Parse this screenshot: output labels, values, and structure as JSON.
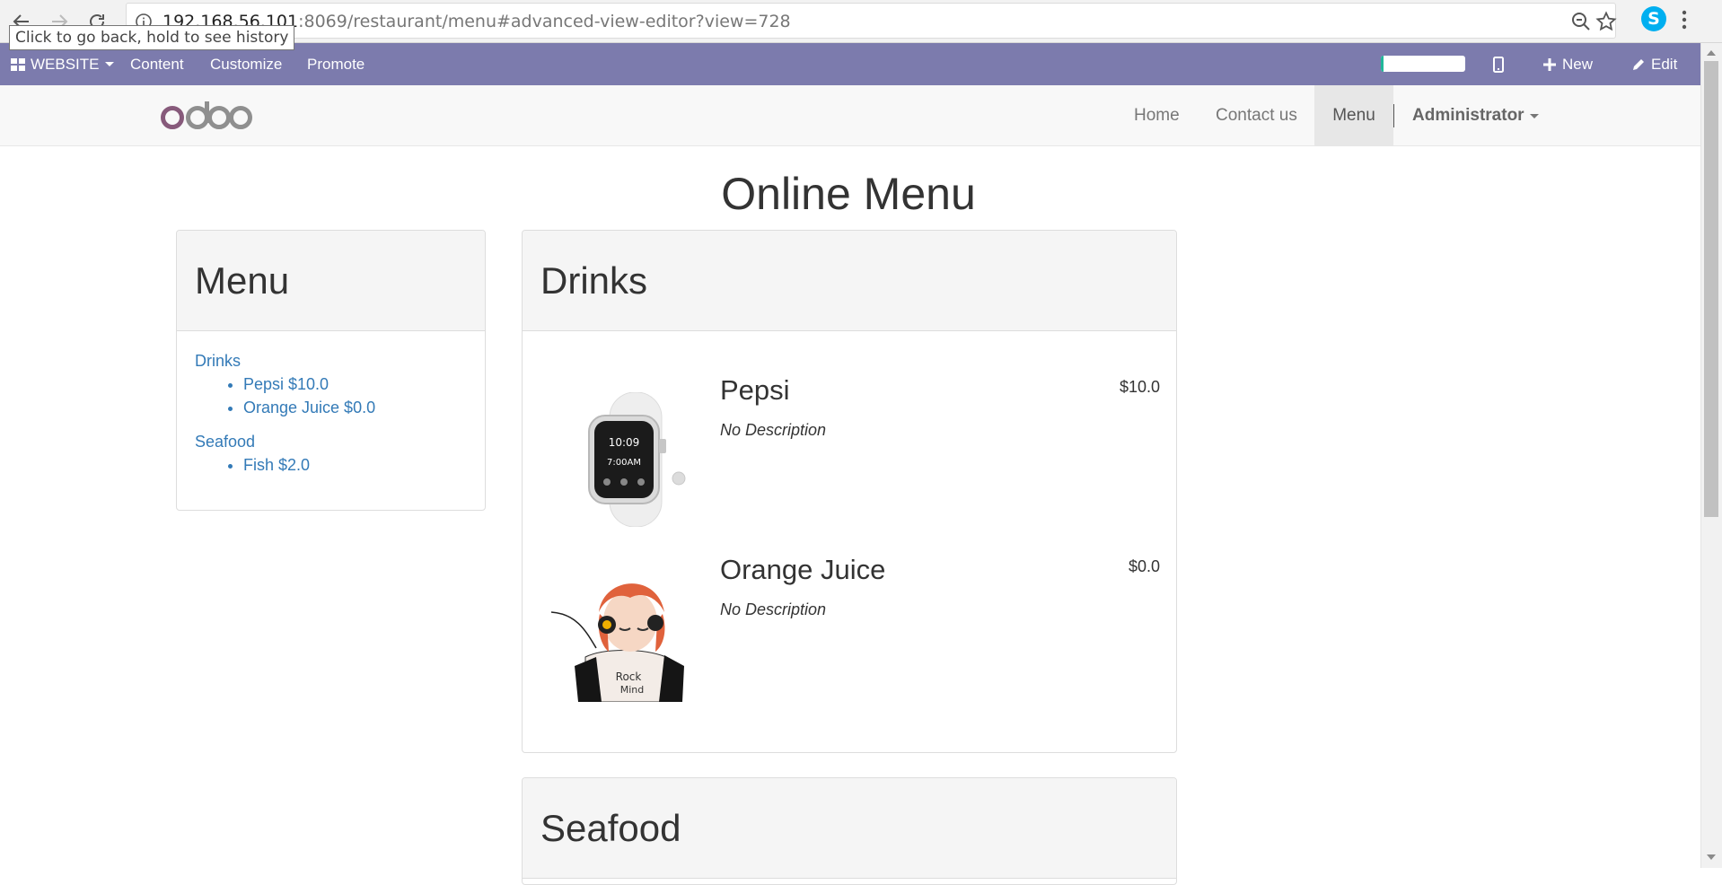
{
  "browser": {
    "url_host": "192.168.56.101",
    "url_path": ":8069/restaurant/menu#advanced-view-editor?view=728",
    "tooltip": "Click to go back, hold to see history"
  },
  "admin_bar": {
    "website_label": "WEBSITE",
    "content_label": "Content",
    "customize_label": "Customize",
    "promote_label": "Promote",
    "new_label": "New",
    "edit_label": "Edit",
    "progress_percent": 3
  },
  "navbar": {
    "logo_text": "odoo",
    "links": [
      "Home",
      "Contact us",
      "Menu"
    ],
    "user_label": "Administrator"
  },
  "page": {
    "title": "Online Menu"
  },
  "sidebar": {
    "heading": "Menu",
    "categories": [
      {
        "name": "Drinks",
        "items": [
          "Pepsi $10.0",
          "Orange Juice $0.0"
        ]
      },
      {
        "name": "Seafood",
        "items": [
          "Fish $2.0"
        ]
      }
    ]
  },
  "sections": [
    {
      "heading": "Drinks",
      "items": [
        {
          "name": "Pepsi",
          "description": "No Description",
          "price": "$10.0",
          "image": "smartwatch-image"
        },
        {
          "name": "Orange Juice",
          "description": "No Description",
          "price": "$0.0",
          "image": "anime-girl-image"
        }
      ]
    },
    {
      "heading": "Seafood"
    }
  ],
  "colors": {
    "admin_bar": "#7c7bad",
    "logo_o": "#875a7b",
    "logo_doo": "#8f8f8f",
    "link": "#337ab7",
    "progress": "#21b799"
  }
}
